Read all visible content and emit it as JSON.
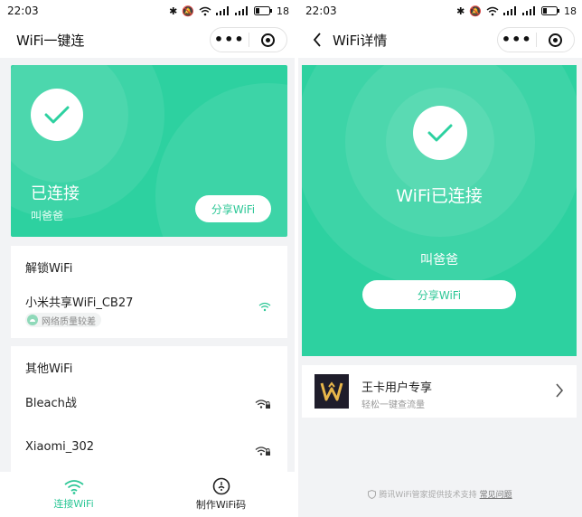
{
  "colors": {
    "accent_green": "#2dd1a0",
    "text_green": "#2cc796",
    "background": "#f2f3f5"
  },
  "left": {
    "status_bar": {
      "time": "22:03",
      "battery": "18"
    },
    "nav": {
      "title": "WiFi一键连"
    },
    "hero": {
      "status": "已连接",
      "ssid": "叫爸爸",
      "share_label": "分享WiFi"
    },
    "unlock_section": {
      "title": "解锁WiFi",
      "items": [
        {
          "name": "小米共享WiFi_CB27",
          "badge": "网络质量较差",
          "icon": "wifi-signal-icon"
        }
      ]
    },
    "other_section": {
      "title": "其他WiFi",
      "items": [
        {
          "name": "Bleach战",
          "icon": "wifi-lock-icon"
        },
        {
          "name": "Xiaomi_302",
          "icon": "wifi-lock-icon"
        }
      ]
    },
    "tabbar": {
      "tabs": [
        {
          "label": "连接WiFi",
          "icon": "wifi-icon"
        },
        {
          "label": "制作WiFi码",
          "icon": "wifi-code-icon"
        }
      ]
    }
  },
  "right": {
    "status_bar": {
      "time": "22:03",
      "battery": "18"
    },
    "nav": {
      "title": "WiFi详情"
    },
    "hero": {
      "title": "WiFi已连接",
      "ssid": "叫爸爸",
      "share_label": "分享WiFi"
    },
    "promo": {
      "title": "王卡用户专享",
      "subtitle": "轻松一键查流量"
    },
    "footer": {
      "text": "腾讯WiFi管家提供技术支持",
      "link": "常见问题"
    }
  }
}
